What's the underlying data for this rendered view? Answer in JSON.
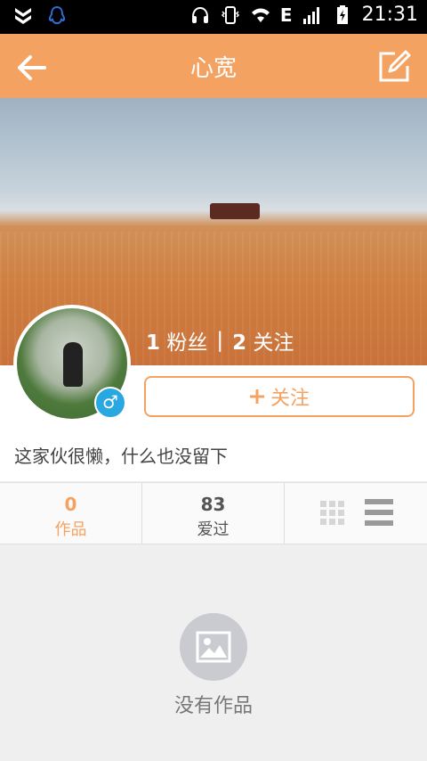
{
  "status": {
    "time": "21:31",
    "network": "E"
  },
  "header": {
    "title": "心宽"
  },
  "profile": {
    "fans_count": "1",
    "fans_label": "粉丝",
    "following_count": "2",
    "following_label": "关注",
    "separator": "|",
    "follow_button_label": "关注",
    "gender_symbol": "♂",
    "bio": "这家伙很懒，什么也没留下"
  },
  "tabs": [
    {
      "count": "0",
      "label": "作品"
    },
    {
      "count": "83",
      "label": "爱过"
    }
  ],
  "empty_state": {
    "label": "没有作品"
  },
  "colors": {
    "accent": "#f4a261",
    "male_blue": "#28a7e1"
  }
}
